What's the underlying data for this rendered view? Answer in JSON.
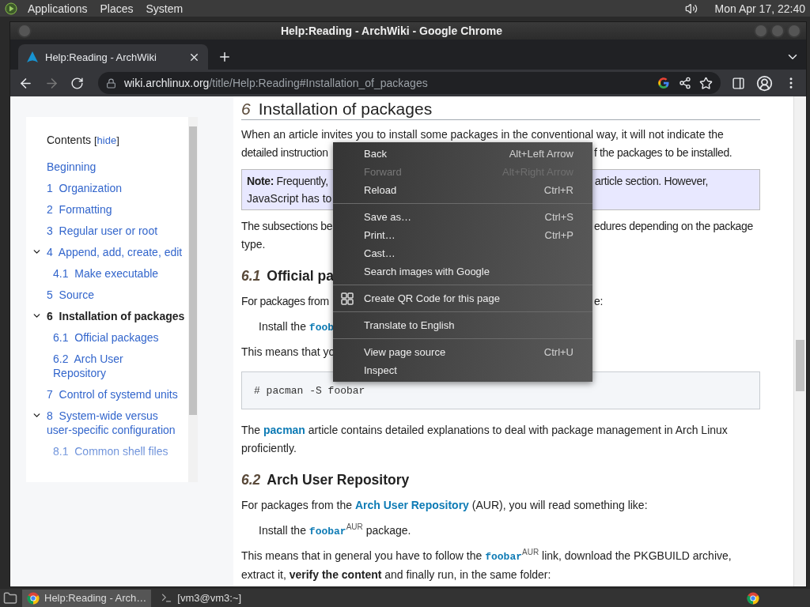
{
  "top_panel": {
    "menus": [
      "Applications",
      "Places",
      "System"
    ],
    "clock": "Mon Apr 17, 22:40"
  },
  "window": {
    "title": "Help:Reading - ArchWiki - Google Chrome"
  },
  "tabs": [
    {
      "label": "Help:Reading - ArchWiki",
      "selected": true
    }
  ],
  "address_bar": {
    "host": "wiki.archlinux.org",
    "path": "/title/Help:Reading#Installation_of_packages"
  },
  "toc": {
    "title": "Contents",
    "hide_toggle": [
      {
        "kind": "plain",
        "text": "["
      },
      {
        "kind": "link",
        "text": "hide"
      },
      {
        "kind": "plain",
        "text": "]"
      }
    ],
    "items": [
      {
        "label": "Beginning",
        "selected": false
      },
      {
        "number": "1",
        "label": "Organization",
        "selected": false
      },
      {
        "number": "2",
        "label": "Formatting",
        "selected": false
      },
      {
        "number": "3",
        "label": "Regular user or root",
        "selected": false
      },
      {
        "number": "4",
        "label": "Append, add, create, edit",
        "selected": false,
        "expanded": true,
        "children": [
          {
            "number": "4.1",
            "label": "Make executable",
            "selected": false
          }
        ]
      },
      {
        "number": "5",
        "label": "Source",
        "selected": false
      },
      {
        "number": "6",
        "label": "Installation of packages",
        "selected": true,
        "expanded": true,
        "children": [
          {
            "number": "6.1",
            "label": "Official packages",
            "selected": false
          },
          {
            "number": "6.2",
            "label": "Arch User Repository",
            "selected": false
          }
        ]
      },
      {
        "number": "7",
        "label": "Control of systemd units",
        "selected": false
      },
      {
        "number": "8",
        "label": "System-wide versus user-specific configuration",
        "selected": false,
        "expanded": true,
        "children": [
          {
            "number": "8.1",
            "label": "Common shell files",
            "selected": false
          }
        ]
      }
    ]
  },
  "article": {
    "heading_number": "6",
    "heading": "Installation of packages",
    "blocks": [
      {
        "kind": "covered",
        "lines": [
          {
            "left": [
              {
                "kind": "plain",
                "text": "When an article invites you to install some packages in the conventional way, it will not indicate the"
              }
            ]
          },
          {
            "left": [
              {
                "kind": "plain",
                "text": "detailed instruction"
              }
            ],
            "right": [
              {
                "kind": "plain",
                "text": "f the packages to be installed."
              }
            ]
          }
        ]
      },
      {
        "kind": "note",
        "lines": [
          {
            "left": [
              {
                "kind": "bold",
                "text": "Note:"
              },
              {
                "kind": "plain",
                "text": " Frequently,"
              }
            ],
            "right": [
              {
                "kind": "plain",
                "text": "article section. However,"
              }
            ]
          },
          {
            "left": [
              {
                "kind": "plain",
                "text": "JavaScript has to"
              }
            ]
          }
        ]
      },
      {
        "kind": "covered",
        "lines": [
          {
            "left": [
              {
                "kind": "plain",
                "text": "The subsections be"
              }
            ],
            "right": [
              {
                "kind": "plain",
                "text": "edures depending on the package"
              }
            ]
          },
          {
            "left": [
              {
                "kind": "plain",
                "text": "type."
              }
            ]
          }
        ]
      },
      {
        "kind": "heading",
        "number": "6.1",
        "title": "Official pa"
      },
      {
        "kind": "covered",
        "lines": [
          {
            "left": [
              {
                "kind": "plain",
                "text": "For packages from"
              }
            ],
            "right": [
              {
                "kind": "plain",
                "text": "e:"
              }
            ]
          }
        ]
      },
      {
        "kind": "covered_quote",
        "lines": [
          {
            "left": [
              {
                "kind": "plain",
                "text": "Install the "
              },
              {
                "kind": "code",
                "text": "foob"
              }
            ]
          }
        ]
      },
      {
        "kind": "covered",
        "lines": [
          {
            "left": [
              {
                "kind": "plain",
                "text": "This means that yo"
              }
            ]
          }
        ]
      },
      {
        "kind": "code",
        "text": "# pacman -S foobar"
      },
      {
        "kind": "paragraph",
        "parts": [
          {
            "kind": "plain",
            "text": "The "
          },
          {
            "kind": "link",
            "text": "pacman"
          },
          {
            "kind": "plain",
            "text": " article contains detailed explanations to deal with package management in Arch Linux proficiently."
          }
        ]
      },
      {
        "kind": "heading",
        "number": "6.2",
        "title": "Arch User Repository"
      },
      {
        "kind": "paragraph",
        "parts": [
          {
            "kind": "plain",
            "text": "For packages from the "
          },
          {
            "kind": "link",
            "text": "Arch User Repository"
          },
          {
            "kind": "plain",
            "text": " (AUR), you will read something like:"
          }
        ]
      },
      {
        "kind": "quote",
        "parts": [
          {
            "kind": "plain",
            "text": "Install the "
          },
          {
            "kind": "code",
            "text": "foobar"
          },
          {
            "kind": "sup",
            "text": "AUR"
          },
          {
            "kind": "plain",
            "text": " package."
          }
        ]
      },
      {
        "kind": "paragraph",
        "parts": [
          {
            "kind": "plain",
            "text": "This means that in general you have to follow the "
          },
          {
            "kind": "code",
            "text": "foobar"
          },
          {
            "kind": "sup",
            "text": "AUR"
          },
          {
            "kind": "plain",
            "text": " link, download the PKGBUILD archive, extract it, "
          },
          {
            "kind": "bold",
            "text": "verify the content"
          },
          {
            "kind": "plain",
            "text": " and finally run, in the same folder:"
          }
        ]
      }
    ]
  },
  "context_menu": {
    "groups": [
      [
        {
          "label": "Back",
          "shortcut": "Alt+Left Arrow",
          "disabled": false,
          "kind": "plain"
        },
        {
          "label": "Forward",
          "shortcut": "Alt+Right Arrow",
          "disabled": true,
          "kind": "plain"
        },
        {
          "label": "Reload",
          "shortcut": "Ctrl+R",
          "disabled": false,
          "kind": "plain"
        }
      ],
      [
        {
          "label": "Save as…",
          "shortcut": "Ctrl+S",
          "disabled": false,
          "kind": "plain"
        },
        {
          "label": "Print…",
          "shortcut": "Ctrl+P",
          "disabled": false,
          "kind": "plain"
        },
        {
          "label": "Cast…",
          "disabled": false,
          "kind": "plain"
        },
        {
          "label": "Search images with Google",
          "disabled": false,
          "kind": "plain"
        }
      ],
      [
        {
          "label": "Create QR Code for this page",
          "disabled": false,
          "kind": "with_icon"
        }
      ],
      [
        {
          "label": "Translate to English",
          "disabled": false,
          "kind": "plain"
        }
      ],
      [
        {
          "label": "View page source",
          "shortcut": "Ctrl+U",
          "disabled": false,
          "kind": "plain"
        },
        {
          "label": "Inspect",
          "disabled": false,
          "kind": "plain"
        }
      ]
    ]
  },
  "taskbar": {
    "items": [
      {
        "label": "Help:Reading - Arch…",
        "selected": true,
        "kind": "browser"
      },
      {
        "label": "[vm3@vm3:~]",
        "selected": false,
        "kind": "terminal"
      }
    ]
  }
}
